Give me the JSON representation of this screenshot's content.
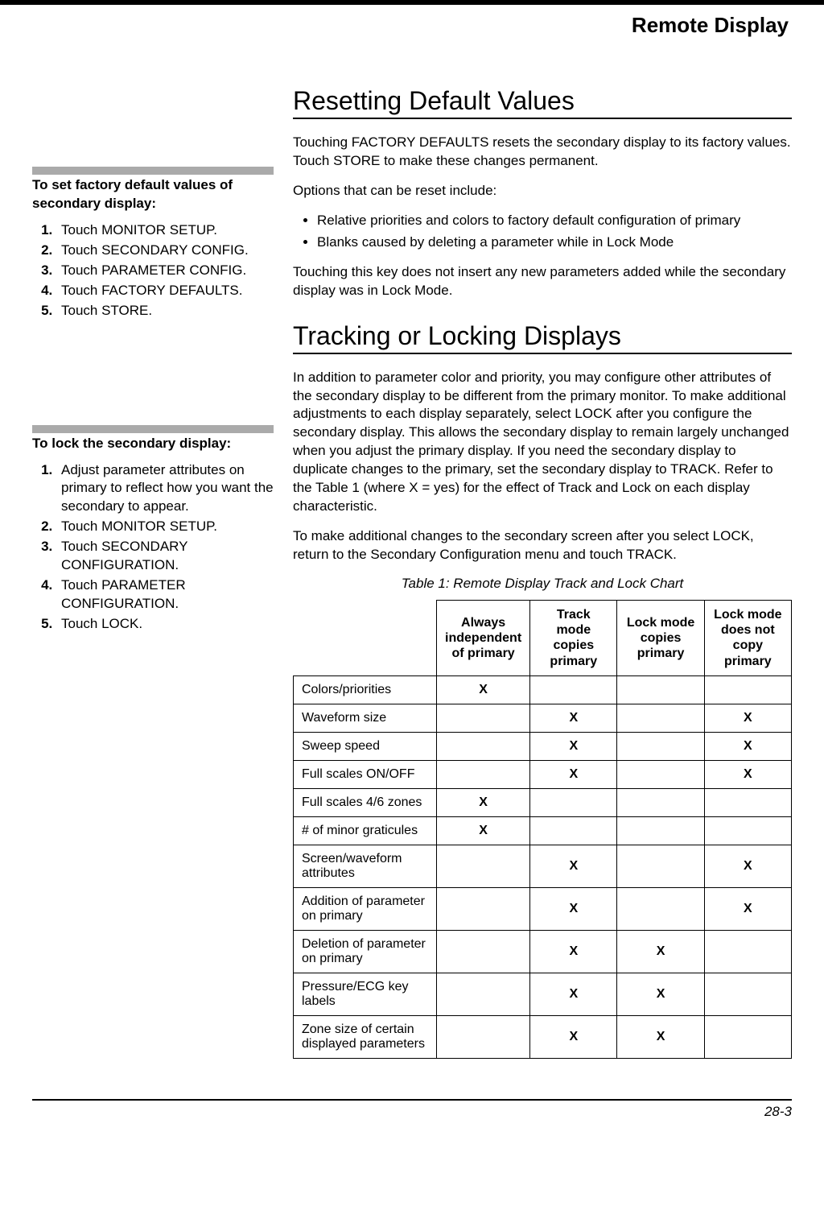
{
  "header": {
    "title": "Remote Display"
  },
  "sidebar": {
    "block1": {
      "heading": "To set factory default values of secondary display:",
      "steps": [
        "Touch MONITOR SETUP.",
        "Touch SECONDARY CONFIG.",
        "Touch PARAMETER CONFIG.",
        "Touch FACTORY DEFAULTS.",
        "Touch STORE."
      ]
    },
    "block2": {
      "heading": "To lock the secondary display:",
      "steps": [
        "Adjust parameter attributes on primary to reflect how you want the secondary to appear.",
        "Touch MONITOR SETUP.",
        "Touch SECONDARY CONFIGURATION.",
        "Touch PARAMETER CONFIGURATION.",
        "Touch LOCK."
      ]
    }
  },
  "main": {
    "s1": {
      "title": "Resetting Default Values",
      "p1": "Touching FACTORY DEFAULTS resets the secondary display to its factory values. Touch STORE to make these changes permanent.",
      "p2": "Options that can be reset include:",
      "bullets": [
        "Relative priorities and colors to factory default configuration of primary",
        "Blanks caused by deleting a parameter while in Lock Mode"
      ],
      "p3": "Touching this key does not insert any new parameters added while the secondary display was in Lock Mode."
    },
    "s2": {
      "title": "Tracking or Locking Displays",
      "p1": "In addition to parameter color and priority, you may configure other attributes of the secondary display to be different from the primary monitor. To make additional adjustments to each display separately, select LOCK after you configure the secondary display. This allows the secondary display to remain largely unchanged when you adjust the primary display. If you need the secondary display to duplicate changes to the primary, set the secondary display to TRACK. Refer to the Table 1 (where X = yes) for the effect of Track and Lock on each display characteristic.",
      "p2": "To make additional changes to the secondary screen after you select LOCK, return to the Secondary Configuration menu and touch TRACK.",
      "table_caption": "Table 1: Remote Display Track and Lock Chart",
      "table": {
        "headers": [
          "Always independent of primary",
          "Track mode copies primary",
          "Lock mode copies primary",
          "Lock mode does not copy primary"
        ],
        "rows": [
          {
            "label": "Colors/priorities",
            "c": [
              "X",
              "",
              "",
              ""
            ]
          },
          {
            "label": "Waveform size",
            "c": [
              "",
              "X",
              "",
              "X"
            ]
          },
          {
            "label": "Sweep speed",
            "c": [
              "",
              "X",
              "",
              "X"
            ]
          },
          {
            "label": "Full scales ON/OFF",
            "c": [
              "",
              "X",
              "",
              "X"
            ]
          },
          {
            "label": "Full scales 4/6 zones",
            "c": [
              "X",
              "",
              "",
              ""
            ]
          },
          {
            "label": "# of minor graticules",
            "c": [
              "X",
              "",
              "",
              ""
            ]
          },
          {
            "label": "Screen/waveform attributes",
            "c": [
              "",
              "X",
              "",
              "X"
            ]
          },
          {
            "label": "Addition of parameter on primary",
            "c": [
              "",
              "X",
              "",
              "X"
            ]
          },
          {
            "label": "Deletion of parameter on primary",
            "c": [
              "",
              "X",
              "X",
              ""
            ]
          },
          {
            "label": "Pressure/ECG key labels",
            "c": [
              "",
              "X",
              "X",
              ""
            ]
          },
          {
            "label": "Zone size of certain displayed parameters",
            "c": [
              "",
              "X",
              "X",
              ""
            ]
          }
        ]
      }
    }
  },
  "footer": {
    "page": "28-3"
  }
}
